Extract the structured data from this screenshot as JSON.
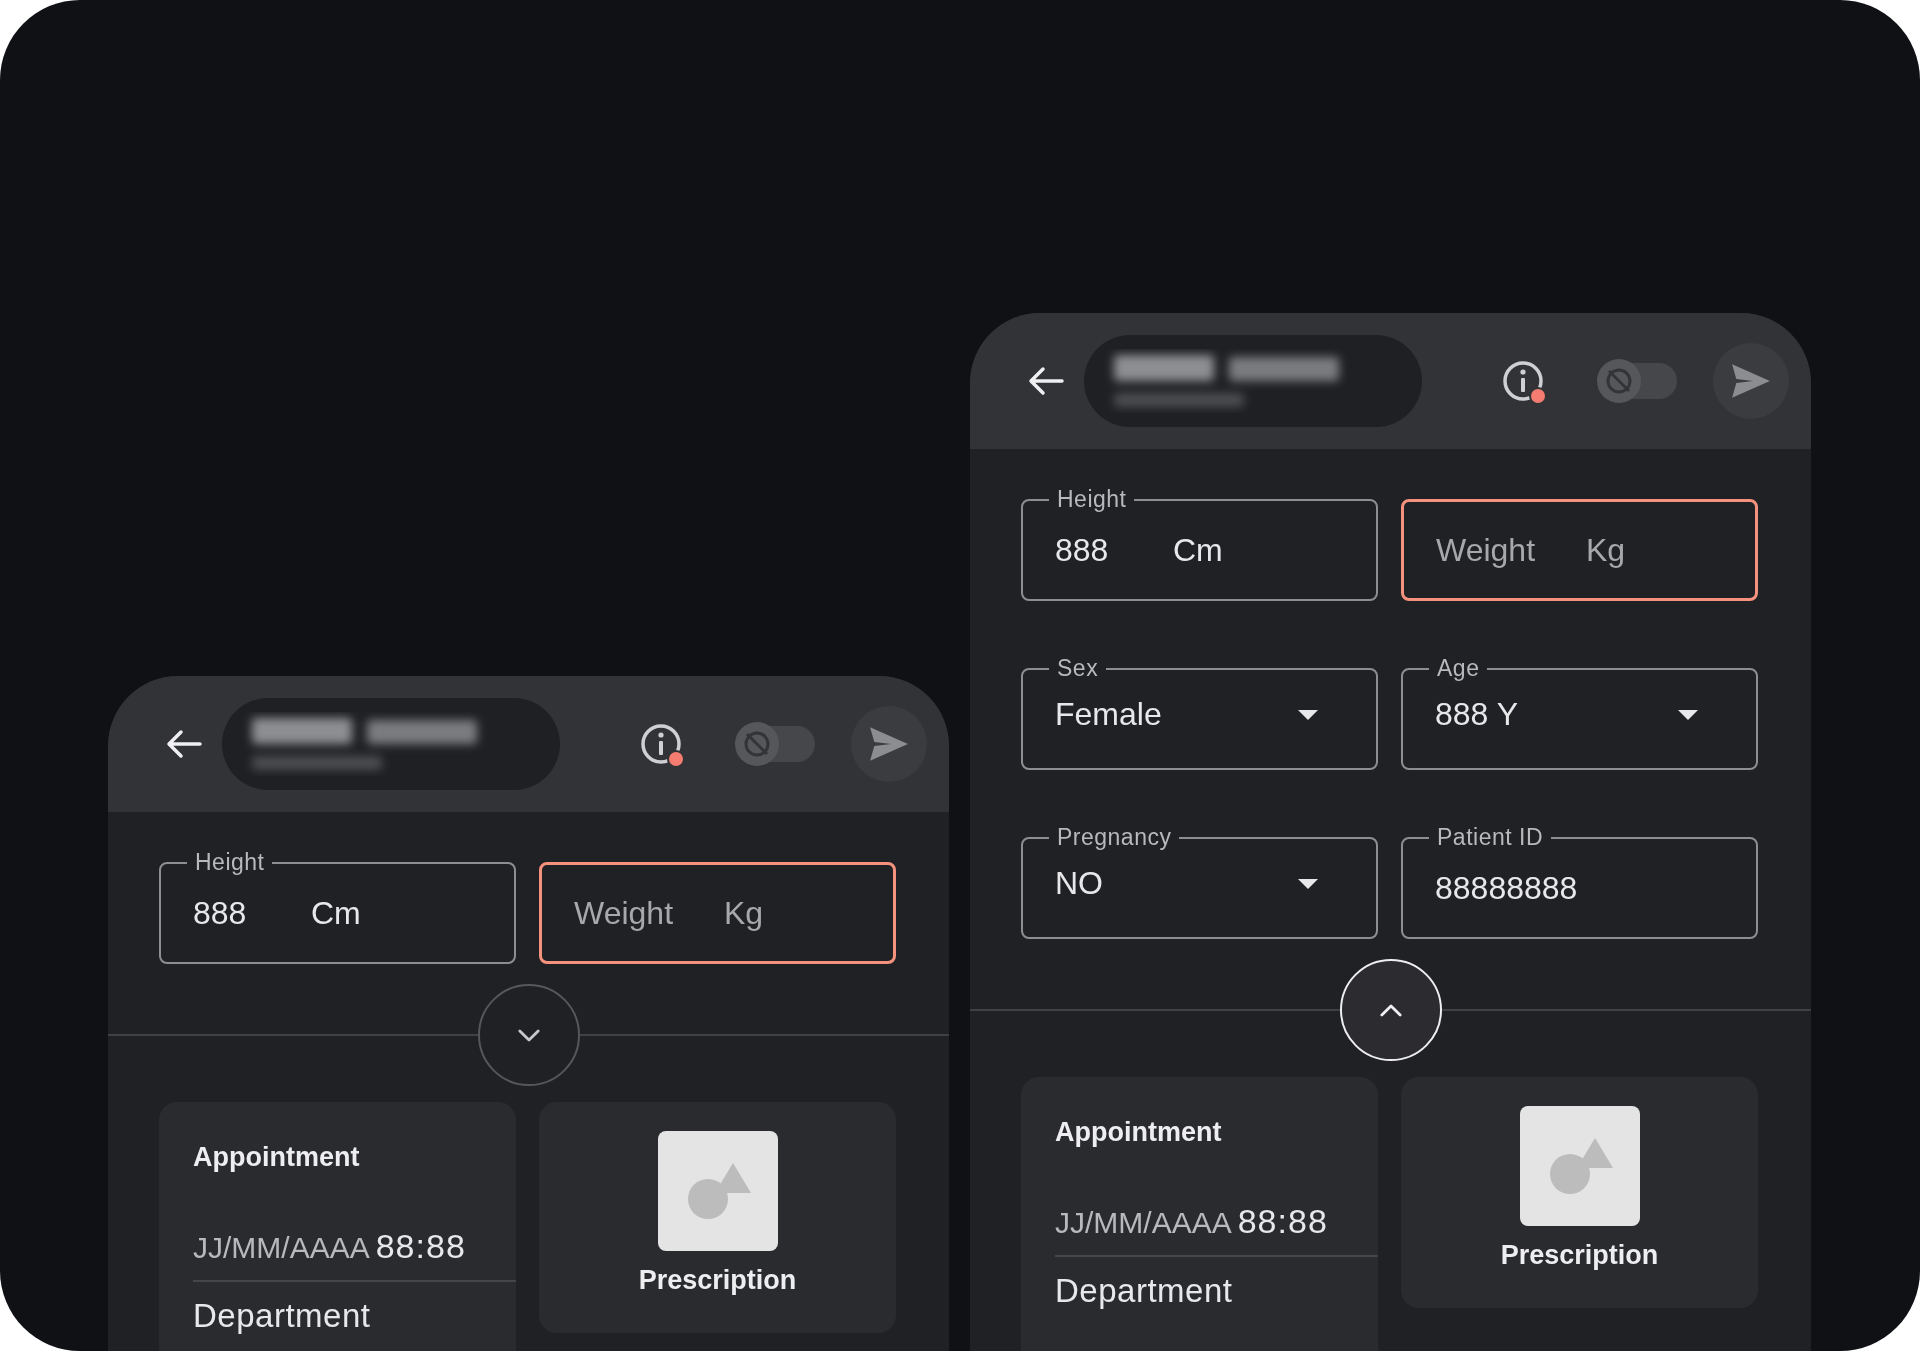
{
  "screens": [
    {
      "header": {
        "alert": true,
        "toggle_on": false
      },
      "fields": [
        {
          "kind": "text",
          "label": "Height",
          "value": "888",
          "suffix": "Cm",
          "error": false
        },
        {
          "kind": "text",
          "placeholder": "Weight",
          "suffix": "Kg",
          "error": true
        }
      ],
      "expanded": false,
      "cards": [
        {
          "kind": "appointment",
          "title": "Appointment",
          "date": "JJ/MM/AAAA",
          "time": "88:88",
          "department": "Department"
        },
        {
          "kind": "shortcut",
          "label": "Prescription"
        }
      ]
    },
    {
      "header": {
        "alert": true,
        "toggle_on": false
      },
      "fields": [
        {
          "kind": "text",
          "label": "Height",
          "value": "888",
          "suffix": "Cm",
          "error": false
        },
        {
          "kind": "text",
          "placeholder": "Weight",
          "suffix": "Kg",
          "error": true
        },
        {
          "kind": "select",
          "label": "Sex",
          "value": "Female",
          "error": false
        },
        {
          "kind": "select",
          "label": "Age",
          "value": "888 Y",
          "error": false
        },
        {
          "kind": "select",
          "label": "Pregnancy",
          "value": "NO",
          "error": false
        },
        {
          "kind": "text",
          "label": "Patient ID",
          "value": "88888888",
          "error": false
        }
      ],
      "expanded": true,
      "cards": [
        {
          "kind": "appointment",
          "title": "Appointment",
          "date": "JJ/MM/AAAA",
          "time": "88:88",
          "department": "Department"
        },
        {
          "kind": "shortcut",
          "label": "Prescription"
        }
      ]
    }
  ]
}
